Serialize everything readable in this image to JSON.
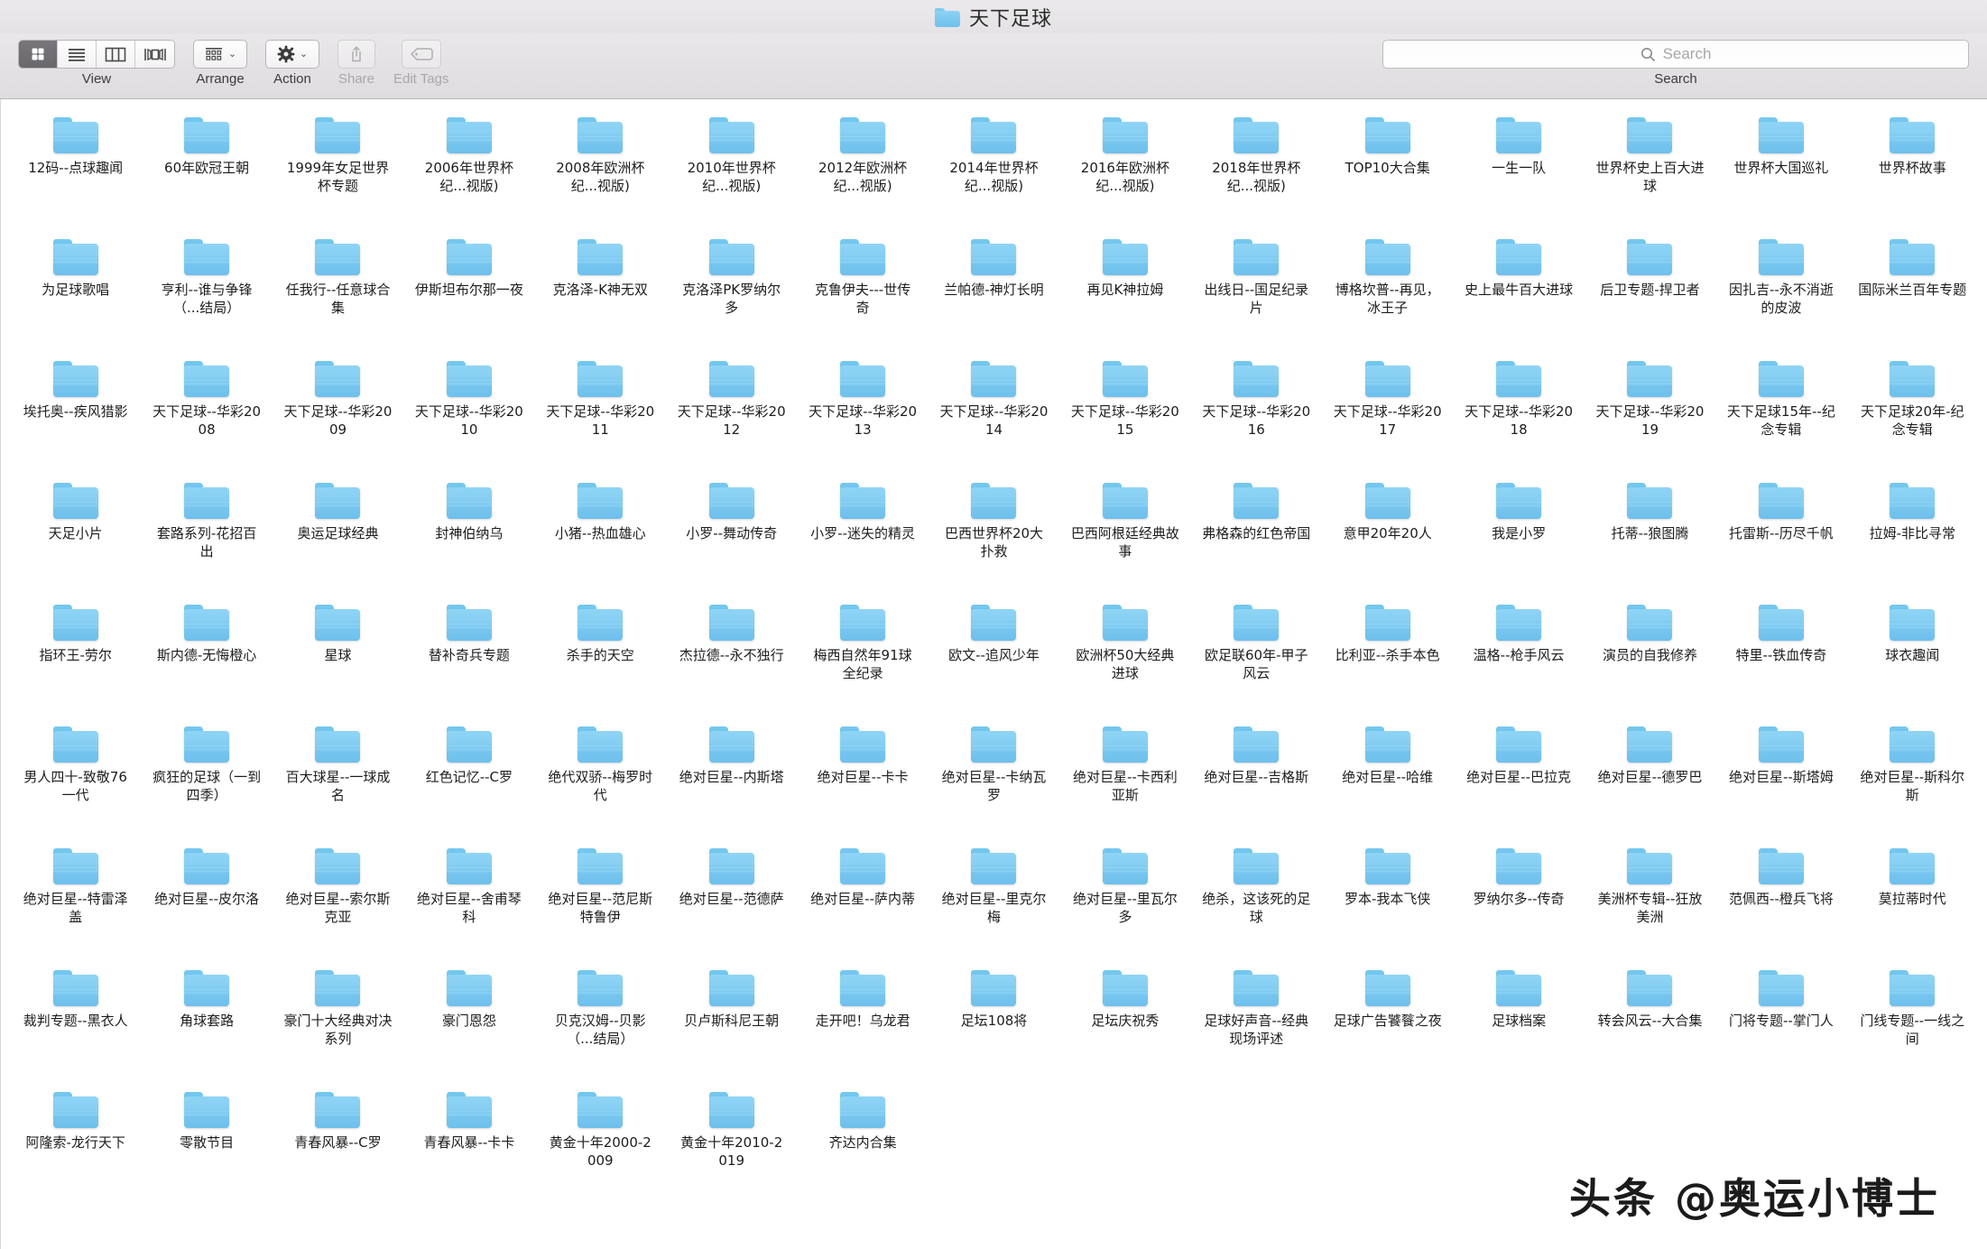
{
  "window": {
    "title": "天下足球",
    "title_icon": "folder-icon"
  },
  "toolbar": {
    "view": {
      "label": "View",
      "options": [
        {
          "name": "icon-view",
          "icon": "grid-icon",
          "active": true
        },
        {
          "name": "list-view",
          "icon": "list-icon",
          "active": false
        },
        {
          "name": "column-view",
          "icon": "columns-icon",
          "active": false
        },
        {
          "name": "gallery-view",
          "icon": "gallery-icon",
          "active": false
        }
      ]
    },
    "arrange": {
      "label": "Arrange",
      "icon": "arrange-grid-icon",
      "chevron": "⌄"
    },
    "action": {
      "label": "Action",
      "icon": "gear-icon",
      "chevron": "⌄"
    },
    "share": {
      "label": "Share",
      "icon": "share-icon",
      "disabled": true
    },
    "edit_tags": {
      "label": "Edit Tags",
      "icon": "tag-icon",
      "disabled": true
    }
  },
  "search": {
    "label": "Search",
    "placeholder": "Search",
    "value": "",
    "icon": "search-icon"
  },
  "watermark": "头条 @奥运小博士",
  "colors": {
    "folder": "#83cff3",
    "toolbar_bg": "#e4e2e4",
    "titlebar_bg": "#e8e6e8",
    "text": "#1d1d1d"
  },
  "files": [
    "12码--点球趣闻",
    "60年欧冠王朝",
    "1999年女足世界杯专题",
    "2006年世界杯纪...视版)",
    "2008年欧洲杯纪...视版)",
    "2010年世界杯纪...视版)",
    "2012年欧洲杯纪...视版)",
    "2014年世界杯纪...视版)",
    "2016年欧洲杯纪...视版)",
    "2018年世界杯纪...视版)",
    "TOP10大合集",
    "一生一队",
    "世界杯史上百大进球",
    "世界杯大国巡礼",
    "世界杯故事",
    "为足球歌唱",
    "亨利--谁与争锋（...结局）",
    "任我行--任意球合集",
    "伊斯坦布尔那一夜",
    "克洛泽-K神无双",
    "克洛泽PK罗纳尔多",
    "克鲁伊夫---世传奇",
    "兰帕德-神灯长明",
    "再见K神拉姆",
    "出线日--国足纪录片",
    "博格坎普--再见，冰王子",
    "史上最牛百大进球",
    "后卫专题-捍卫者",
    "因扎吉--永不消逝的皮波",
    "国际米兰百年专题",
    "埃托奥--疾风猎影",
    "天下足球--华彩2008",
    "天下足球--华彩2009",
    "天下足球--华彩2010",
    "天下足球--华彩2011",
    "天下足球--华彩2012",
    "天下足球--华彩2013",
    "天下足球--华彩2014",
    "天下足球--华彩2015",
    "天下足球--华彩2016",
    "天下足球--华彩2017",
    "天下足球--华彩2018",
    "天下足球--华彩2019",
    "天下足球15年--纪念专辑",
    "天下足球20年-纪念专辑",
    "天足小片",
    "套路系列-花招百出",
    "奥运足球经典",
    "封神伯纳乌",
    "小猪--热血雄心",
    "小罗--舞动传奇",
    "小罗--迷失的精灵",
    "巴西世界杯20大扑救",
    "巴西阿根廷经典故事",
    "弗格森的红色帝国",
    "意甲20年20人",
    "我是小罗",
    "托蒂--狼图腾",
    "托雷斯--历尽千帆",
    "拉姆-非比寻常",
    "指环王-劳尔",
    "斯内德-无悔橙心",
    "星球",
    "替补奇兵专题",
    "杀手的天空",
    "杰拉德--永不独行",
    "梅西自然年91球全纪录",
    "欧文--追风少年",
    "欧洲杯50大经典进球",
    "欧足联60年-甲子风云",
    "比利亚--杀手本色",
    "温格--枪手风云",
    "演员的自我修养",
    "特里--铁血传奇",
    "球衣趣闻",
    "男人四十-致敬76一代",
    "疯狂的足球（一到四季）",
    "百大球星--一球成名",
    "红色记忆--C罗",
    "绝代双骄--梅罗时代",
    "绝对巨星--内斯塔",
    "绝对巨星--卡卡",
    "绝对巨星--卡纳瓦罗",
    "绝对巨星--卡西利亚斯",
    "绝对巨星--吉格斯",
    "绝对巨星--哈维",
    "绝对巨星--巴拉克",
    "绝对巨星--德罗巴",
    "绝对巨星--斯塔姆",
    "绝对巨星--斯科尔斯",
    "绝对巨星--特雷泽盖",
    "绝对巨星--皮尔洛",
    "绝对巨星--索尔斯克亚",
    "绝对巨星--舍甫琴科",
    "绝对巨星--范尼斯特鲁伊",
    "绝对巨星--范德萨",
    "绝对巨星--萨内蒂",
    "绝对巨星--里克尔梅",
    "绝对巨星--里瓦尔多",
    "绝杀，这该死的足球",
    "罗本-我本飞侠",
    "罗纳尔多--传奇",
    "美洲杯专辑--狂放美洲",
    "范佩西--橙兵飞将",
    "莫拉蒂时代",
    "裁判专题--黑衣人",
    "角球套路",
    "豪门十大经典对决系列",
    "豪门恩怨",
    "贝克汉姆--贝影（...结局）",
    "贝卢斯科尼王朝",
    "走开吧！乌龙君",
    "足坛108将",
    "足坛庆祝秀",
    "足球好声音--经典现场评述",
    "足球广告饕餮之夜",
    "足球档案",
    "转会风云--大合集",
    "门将专题--掌门人",
    "门线专题--一线之间",
    "阿隆索-龙行天下",
    "零散节目",
    "青春风暴--C罗",
    "青春风暴--卡卡",
    "黄金十年2000-2009",
    "黄金十年2010-2019",
    "齐达内合集"
  ]
}
